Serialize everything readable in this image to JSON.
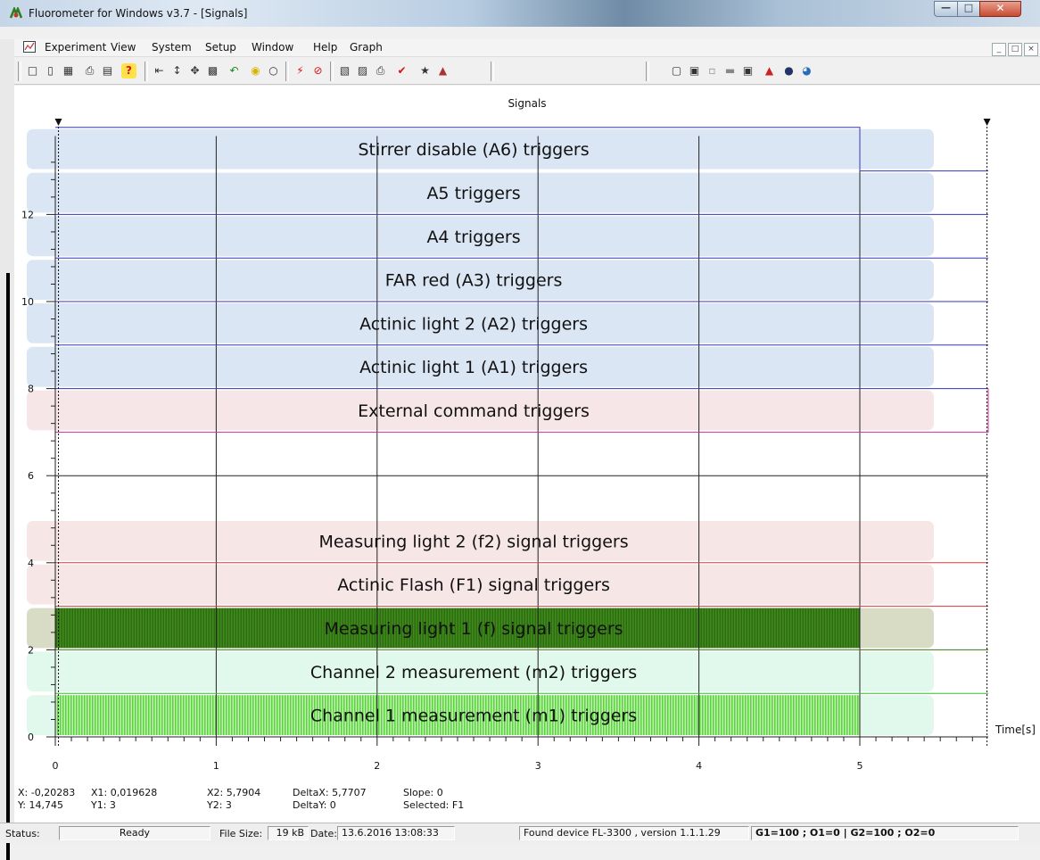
{
  "window": {
    "title": "Fluorometer for Windows v3.7 - [Signals]"
  },
  "menu": [
    "Experiment",
    "View",
    "System",
    "Setup",
    "Window",
    "Help",
    "Graph"
  ],
  "toolbar_icons": [
    "new-icon",
    "open-icon",
    "save-icon",
    "print-icon",
    "print-preview-icon",
    "help-icon",
    "fit-horizontal-icon",
    "fit-vertical-icon",
    "zoom-fit-icon",
    "copy-graph-icon",
    "undo-icon",
    "light-on-icon",
    "light-off-icon",
    "flash-icon",
    "stop-icon",
    "load-protocol-icon",
    "save-protocol-icon",
    "print-protocol-icon",
    "check-icon",
    "wizard-icon",
    "export-icon",
    "chart-icon",
    "settings-icon",
    "copy-icon",
    "card-icon",
    "graph-settings-icon",
    "transfer-icon",
    "device-icon",
    "globe-icon"
  ],
  "graph": {
    "title": "Signals",
    "x_axis_label": "Time[s]"
  },
  "chart_data": {
    "type": "line",
    "title": "Signals",
    "xlabel": "Time[s]",
    "ylabel": "",
    "xlim": [
      0,
      5.8
    ],
    "ylim": [
      0,
      14
    ],
    "x_ticks": [
      "0",
      "1",
      "2",
      "3",
      "4",
      "5"
    ],
    "y_ticks": [
      "0",
      "2",
      "4",
      "6",
      "8",
      "10",
      "12"
    ],
    "series": [
      {
        "name": "Stirrer disable (A6) triggers",
        "color": "#3535b5",
        "bg": "#dbe6f4",
        "base": 13,
        "level": 1,
        "hatch": false,
        "step_to": 0,
        "step_at": 5
      },
      {
        "name": "A5 triggers",
        "color": "#3535b5",
        "bg": "#dbe6f4",
        "base": 12,
        "level": 0,
        "hatch": false
      },
      {
        "name": "A4 triggers",
        "color": "#3535b5",
        "bg": "#dbe6f4",
        "base": 11,
        "level": 0,
        "hatch": false
      },
      {
        "name": "FAR red (A3) triggers",
        "color": "#3535b5",
        "bg": "#dbe6f4",
        "base": 10,
        "level": 0,
        "hatch": false
      },
      {
        "name": "Actinic light 2 (A2) triggers",
        "color": "#3535b5",
        "bg": "#dbe6f4",
        "base": 9,
        "level": 0,
        "hatch": false
      },
      {
        "name": "Actinic light 1 (A1) triggers",
        "color": "#3535b5",
        "bg": "#dbe6f4",
        "base": 8,
        "level": 0,
        "hatch": false
      },
      {
        "name": "External command triggers",
        "color": "#cc2f9d",
        "bg": "#f6e6e8",
        "base": 7,
        "level": 0,
        "hatch": false,
        "end_spike": true
      },
      {
        "name": "Measuring light 2 (f2) signal triggers",
        "color": "#d63a3a",
        "bg": "#f6e6e6",
        "base": 4,
        "level": 0,
        "hatch": false
      },
      {
        "name": "Actinic Flash (F1) signal triggers",
        "color": "#d63a3a",
        "bg": "#f6e6e6",
        "base": 3,
        "level": 0,
        "hatch": false
      },
      {
        "name": "Measuring light 1 (f) signal triggers",
        "color": "#3c7a18",
        "bg": "#d8dcc5",
        "base": 2,
        "level": 0,
        "hatch": true,
        "hatch_color": "#3f8a1e",
        "hatch_bg": "#2f6c10"
      },
      {
        "name": "Channel 2 measurement (m2) triggers",
        "color": "#33bb33",
        "bg": "#e1f9ec",
        "base": 1,
        "level": 0,
        "hatch": false
      },
      {
        "name": "Channel 1 measurement (m1) triggers",
        "color": "#33bb33",
        "bg": "#e1f9ec",
        "base": 0,
        "level": 0,
        "hatch": true,
        "hatch_color": "#5ad43a",
        "hatch_bg": "#bdf1b1"
      }
    ],
    "cursor_x": [
      0.019628,
      5.7904
    ]
  },
  "readout": {
    "x": "X: -0,20283",
    "y": "Y: 14,745",
    "x1": "X1: 0,019628",
    "y1": "Y1: 3",
    "x2": "X2: 5,7904",
    "y2": "Y2: 3",
    "dx": "DeltaX: 5,7707",
    "dy": "DeltaY: 0",
    "slope": "Slope: 0",
    "selected": "Selected: F1"
  },
  "status": {
    "status_label": "Status:",
    "status_value": "Ready",
    "filesize_label": "File Size:",
    "filesize_value": "19 kB",
    "date_label": "Date:",
    "date_value": "13.6.2016 13:08:33",
    "device": "Found device FL-3300 , version 1.1.1.29",
    "gains": "G1=100 ; O1=0  |  G2=100 ; O2=0"
  }
}
